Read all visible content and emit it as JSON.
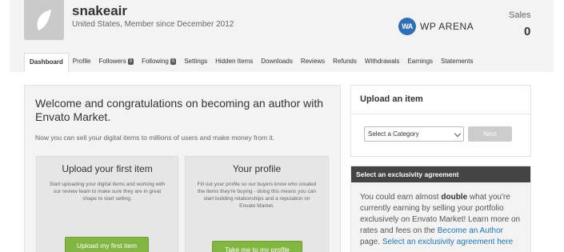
{
  "profile": {
    "username": "snakeair",
    "member_line": "United States, Member since December 2012",
    "sales_label": "Sales",
    "sales_value": "0"
  },
  "brand": {
    "logo_letters": "WA",
    "name": "WP ARENA",
    "color": "#2f6fb6"
  },
  "tabs": [
    {
      "label": "Dashboard",
      "active": true
    },
    {
      "label": "Profile"
    },
    {
      "label": "Followers",
      "badge": "0"
    },
    {
      "label": "Following",
      "badge": "0"
    },
    {
      "label": "Settings"
    },
    {
      "label": "Hidden Items"
    },
    {
      "label": "Downloads"
    },
    {
      "label": "Reviews"
    },
    {
      "label": "Refunds"
    },
    {
      "label": "Withdrawals"
    },
    {
      "label": "Earnings"
    },
    {
      "label": "Statements"
    }
  ],
  "welcome": {
    "title": "Welcome and congratulations on becoming an author with Envato Market.",
    "subtitle": "Now you can sell your digital items to millions of users and make money from it.",
    "cards": [
      {
        "title": "Upload your first item",
        "text": "Start uploading your digital items and working with our review team to make sure they are in great shape to start selling.",
        "button": "Upload my first item"
      },
      {
        "title": "Your profile",
        "text": "Fill out your profile so our buyers know who created the items they're buying - doing this means you can start building relationships and a reputation on Envato Market.",
        "button": "Take me to my profile"
      }
    ]
  },
  "upload": {
    "title": "Upload an item",
    "select_value": "Select a Category",
    "next_label": "Next"
  },
  "exclusivity": {
    "header": "Select an exclusivity agreement",
    "text_1": "You could earn almost ",
    "text_bold": "double",
    "text_2": " what you're currently earning by selling your portfolio exclusively on Envato Market! Learn more on rates and fees on the ",
    "link_1": "Become an Author",
    "text_3": " page. ",
    "link_2": "Select an exclusivity agreement here"
  },
  "colors": {
    "accent_green": "#82b541",
    "link_blue": "#1e73b8",
    "dark_header": "#444444"
  }
}
